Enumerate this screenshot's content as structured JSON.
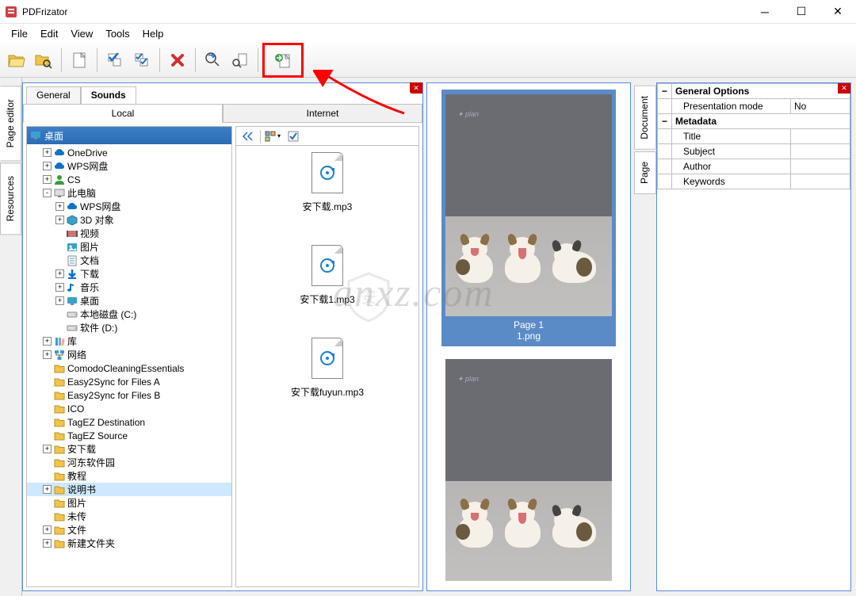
{
  "window": {
    "title": "PDFrizator"
  },
  "menu": [
    "File",
    "Edit",
    "View",
    "Tools",
    "Help"
  ],
  "left_vtabs": [
    "Page editor",
    "Resources"
  ],
  "right_vtabs": [
    "Document",
    "Page"
  ],
  "browser": {
    "top_tabs": [
      "General",
      "Sounds"
    ],
    "sub_tabs": [
      "Local",
      "Internet"
    ],
    "tree_root": "桌面",
    "tree": [
      {
        "ind": 1,
        "exp": "+",
        "icon": "cloud",
        "lbl": "OneDrive",
        "c": "#0f72c7"
      },
      {
        "ind": 1,
        "exp": "+",
        "icon": "cloud",
        "lbl": "WPS网盘",
        "c": "#0f72c7"
      },
      {
        "ind": 1,
        "exp": "+",
        "icon": "user",
        "lbl": "CS",
        "c": "#3a9c3a"
      },
      {
        "ind": 1,
        "exp": "-",
        "icon": "pc",
        "lbl": "此电脑",
        "c": "#555"
      },
      {
        "ind": 2,
        "exp": "+",
        "icon": "cloud",
        "lbl": "WPS网盘",
        "c": "#0f72c7"
      },
      {
        "ind": 2,
        "exp": "+",
        "icon": "cube",
        "lbl": "3D 对象",
        "c": "#3aa0c7"
      },
      {
        "ind": 2,
        "exp": "",
        "icon": "video",
        "lbl": "视频",
        "c": "#c77"
      },
      {
        "ind": 2,
        "exp": "",
        "icon": "pic",
        "lbl": "图片",
        "c": "#3aa0c7"
      },
      {
        "ind": 2,
        "exp": "",
        "icon": "doc",
        "lbl": "文档",
        "c": "#3aa0c7"
      },
      {
        "ind": 2,
        "exp": "+",
        "icon": "down",
        "lbl": "下载",
        "c": "#0a6fd4"
      },
      {
        "ind": 2,
        "exp": "+",
        "icon": "music",
        "lbl": "音乐",
        "c": "#0a6fd4"
      },
      {
        "ind": 2,
        "exp": "+",
        "icon": "desk",
        "lbl": "桌面",
        "c": "#3aa0c7"
      },
      {
        "ind": 2,
        "exp": "",
        "icon": "disk",
        "lbl": "本地磁盘 (C:)",
        "c": "#888"
      },
      {
        "ind": 2,
        "exp": "",
        "icon": "disk",
        "lbl": "软件 (D:)",
        "c": "#888"
      },
      {
        "ind": 1,
        "exp": "+",
        "icon": "lib",
        "lbl": "库",
        "c": "#3aa0c7"
      },
      {
        "ind": 1,
        "exp": "+",
        "icon": "net",
        "lbl": "网络",
        "c": "#3aa0c7"
      },
      {
        "ind": 1,
        "exp": "",
        "icon": "folder",
        "lbl": "ComodoCleaningEssentials",
        "c": "#f2c44b"
      },
      {
        "ind": 1,
        "exp": "",
        "icon": "folder",
        "lbl": "Easy2Sync for Files A",
        "c": "#f2c44b"
      },
      {
        "ind": 1,
        "exp": "",
        "icon": "folder",
        "lbl": "Easy2Sync for Files B",
        "c": "#f2c44b"
      },
      {
        "ind": 1,
        "exp": "",
        "icon": "folder",
        "lbl": "ICO",
        "c": "#f2c44b"
      },
      {
        "ind": 1,
        "exp": "",
        "icon": "folder",
        "lbl": "TagEZ Destination",
        "c": "#f2c44b"
      },
      {
        "ind": 1,
        "exp": "",
        "icon": "folder",
        "lbl": "TagEZ Source",
        "c": "#f2c44b"
      },
      {
        "ind": 1,
        "exp": "+",
        "icon": "folder",
        "lbl": "安下载",
        "c": "#f2c44b"
      },
      {
        "ind": 1,
        "exp": "",
        "icon": "folder",
        "lbl": "河东软件园",
        "c": "#f2c44b"
      },
      {
        "ind": 1,
        "exp": "",
        "icon": "folder",
        "lbl": "教程",
        "c": "#f2c44b"
      },
      {
        "ind": 1,
        "exp": "+",
        "icon": "folder",
        "lbl": "说明书",
        "c": "#f2c44b",
        "sel": true
      },
      {
        "ind": 1,
        "exp": "",
        "icon": "folder",
        "lbl": "图片",
        "c": "#f2c44b"
      },
      {
        "ind": 1,
        "exp": "",
        "icon": "folder",
        "lbl": "未传",
        "c": "#f2c44b"
      },
      {
        "ind": 1,
        "exp": "+",
        "icon": "folder",
        "lbl": "文件",
        "c": "#f2c44b"
      },
      {
        "ind": 1,
        "exp": "+",
        "icon": "folder",
        "lbl": "新建文件夹",
        "c": "#f2c44b"
      }
    ],
    "files": [
      "安下载.mp3",
      "安下载1.mp3",
      "安下载fuyun.mp3"
    ]
  },
  "thumbs": [
    {
      "cap1": "Page 1",
      "cap2": "1.png",
      "sel": true
    },
    {
      "cap1": "",
      "cap2": "",
      "sel": false
    }
  ],
  "props": {
    "section1": "General Options",
    "row1k": "Presentation mode",
    "row1v": "No",
    "section2": "Metadata",
    "row2k": "Title",
    "row2v": "",
    "row3k": "Subject",
    "row3v": "",
    "row4k": "Author",
    "row4v": "",
    "row5k": "Keywords",
    "row5v": ""
  },
  "watermark": "anxz.com"
}
